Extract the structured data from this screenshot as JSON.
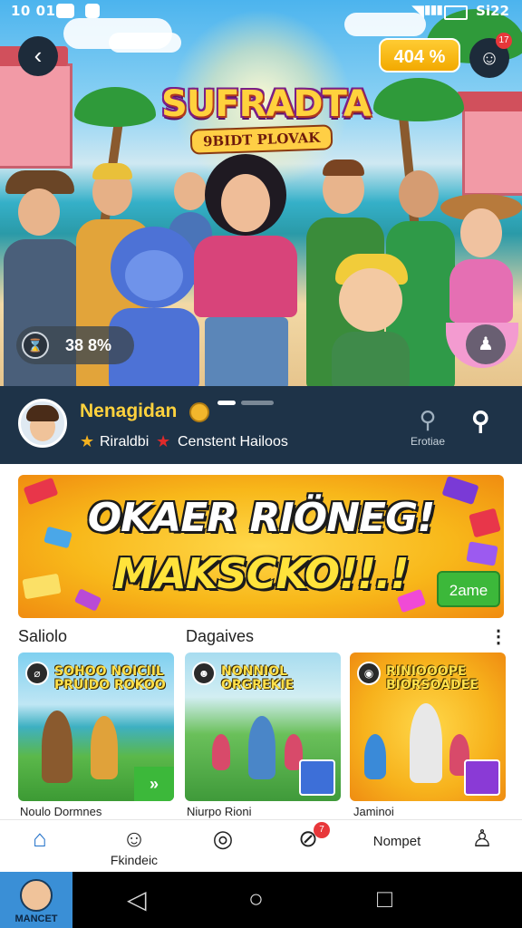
{
  "status": {
    "time": "10 01",
    "right_time": "Si22"
  },
  "hero": {
    "logo_title": "SUFRADTA",
    "logo_subtitle": "9BIDT PLOVAK",
    "points_badge": "404 %",
    "chat_badge_count": "17",
    "progress_pill": "38 8%",
    "carousel_pages": 2,
    "carousel_active": 0
  },
  "profile": {
    "name": "Nenagidan",
    "tag1": "Riraldbi",
    "tag2": "Censtent Hailoos",
    "search_label": "Erotiae"
  },
  "banner": {
    "line1": "OKAER RIÖNEG!",
    "line2": "MAKSCKO!!.!",
    "button": "2ame"
  },
  "sections": {
    "left": "Saliolo",
    "middle": "Dagaives"
  },
  "cards": [
    {
      "title": "SOHOO NOICIIL PRUIDO ROKOO",
      "name": "Noulo Dormnes",
      "icon": "⌀"
    },
    {
      "title": "NONNIOL ORGREKIE",
      "name": "Niurpo Rioni",
      "icon": "☻"
    },
    {
      "title": "RINIOOOPE BIORSOADEE",
      "name": "Jaminoi",
      "icon": "◉"
    }
  ],
  "nav": {
    "item2_label": "Fkindeic",
    "item4_badge": "7",
    "item5_label": "Nompet"
  },
  "system": {
    "avatar_label": "MANCET"
  },
  "colors": {
    "accent": "#1f6fc8",
    "profile_bg": "#1e3348",
    "gold": "#ffd23d",
    "green": "#3cb83a"
  }
}
